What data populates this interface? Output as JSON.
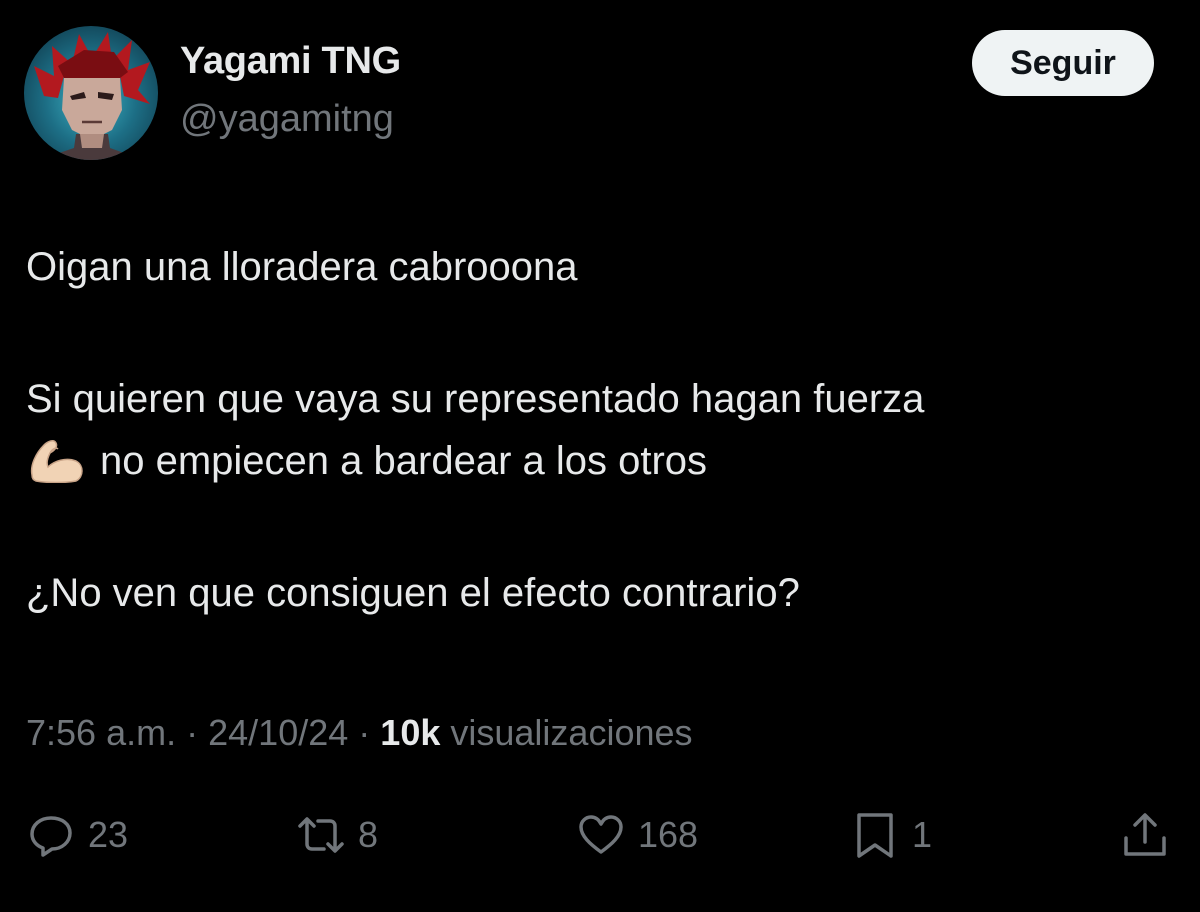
{
  "author": {
    "display_name": "Yagami TNG",
    "handle": "@yagamitng",
    "avatar_icon": "profile-avatar"
  },
  "follow_button": {
    "label": "Seguir"
  },
  "tweet": {
    "paragraphs": [
      {
        "lines": [
          "Oigan una lloradera cabrooona"
        ]
      },
      {
        "lines": [
          "Si quieren que vaya su representado hagan fuerza",
          "no empiecen a bardear a los otros"
        ],
        "emoji": "flexed-biceps"
      },
      {
        "lines": [
          "¿No ven que consiguen el efecto contrario?"
        ]
      }
    ]
  },
  "meta": {
    "time": "7:56 a.m.",
    "separator": "·",
    "date": "24/10/24",
    "views_count": "10k",
    "views_label": "visualizaciones"
  },
  "actions": {
    "replies": "23",
    "retweets": "8",
    "likes": "168",
    "bookmarks": "1"
  },
  "colors": {
    "background": "#000000",
    "text_primary": "#e7e9ea",
    "text_secondary": "#71767b",
    "button_bg": "#eff3f4",
    "button_text": "#0f1419"
  }
}
